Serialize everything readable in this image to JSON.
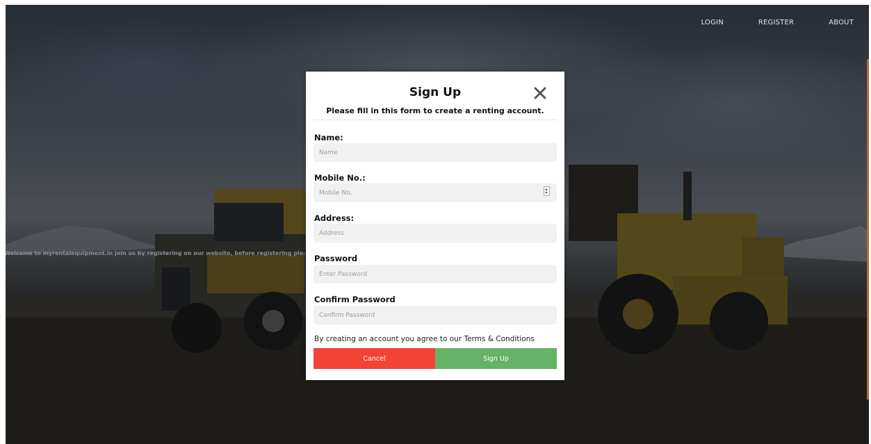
{
  "nav": {
    "login": "LOGIN",
    "register": "REGISTER",
    "about": "ABOUT"
  },
  "marquee_text": "Welcome to myrentalequipment.in join us by registering on our website, before registering please read th",
  "modal": {
    "title": "Sign Up",
    "subtitle": "Please fill in this form to create a renting account.",
    "fields": {
      "name": {
        "label": "Name:",
        "placeholder": "Name"
      },
      "mobile": {
        "label": "Mobile No.:",
        "placeholder": "Mobile No."
      },
      "address": {
        "label": "Address:",
        "placeholder": "Address"
      },
      "password": {
        "label": "Password",
        "placeholder": "Enter Password"
      },
      "confirm": {
        "label": "Confirm Password",
        "placeholder": "Confirm Password"
      }
    },
    "terms": "By creating an account you agree to our Terms & Conditions",
    "cancel_label": "Cancel",
    "signup_label": "Sign Up"
  },
  "colors": {
    "cancel": "#f44336",
    "signup": "#66b266",
    "accent": "#b9652f"
  }
}
